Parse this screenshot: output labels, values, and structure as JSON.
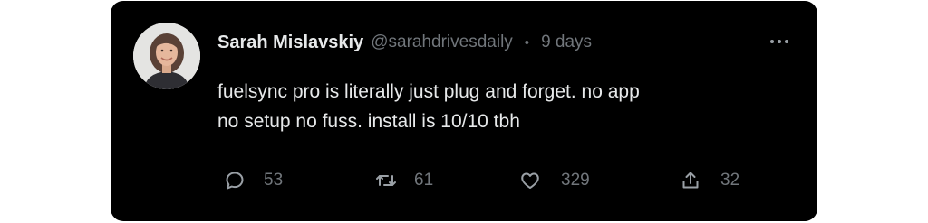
{
  "post": {
    "author_name": "Sarah Mislavskiy",
    "author_handle": "@sarahdrivesdaily",
    "separator": "•",
    "timestamp": "9 days",
    "text_lines": [
      "fuelsync pro is literally just plug and forget. no app",
      "no setup no fuss. install is 10/10 tbh"
    ]
  },
  "actions": {
    "replies": "53",
    "reposts": "61",
    "likes": "329",
    "shares": "32"
  },
  "icons": {
    "reply": "reply-icon",
    "repost": "repost-icon",
    "like": "heart-icon",
    "share": "share-icon",
    "more": "more-icon"
  },
  "colors": {
    "card_background": "#000000",
    "primary_text": "#e7e9ea",
    "secondary_text": "#71767b"
  }
}
